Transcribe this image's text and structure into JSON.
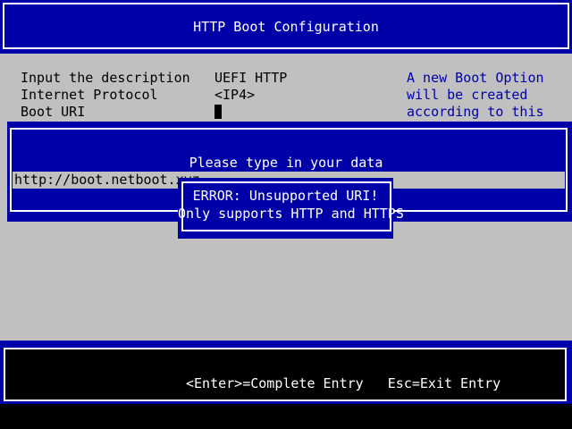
{
  "header": {
    "title": "HTTP Boot Configuration"
  },
  "form": {
    "rows": [
      {
        "label": "Input the description",
        "value": "UEFI HTTP"
      },
      {
        "label": "Internet Protocol",
        "value": "<IP4>"
      },
      {
        "label": "Boot URI",
        "value": ""
      }
    ],
    "help_lines": [
      "A new Boot Option",
      "will be created",
      "according to this"
    ]
  },
  "input_dialog": {
    "prompt": "Please type in your data",
    "value": "http://boot.netboot.xyz"
  },
  "error_popup": {
    "line1": "ERROR: Unsupported URI!",
    "line2": "Only supports HTTP and HTTPS"
  },
  "footer": {
    "enter_hint": "<Enter>=Complete Entry",
    "esc_hint": "Esc=Exit Entry"
  },
  "colors": {
    "background": "#c0c0c0",
    "panel_blue": "#0000a8",
    "text_white": "#ffffff",
    "help_blue": "#0000a8"
  }
}
